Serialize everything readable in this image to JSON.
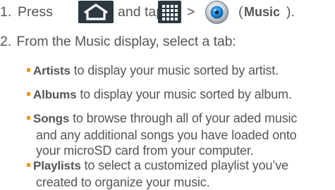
{
  "step1": {
    "number": "1.",
    "press": "Press",
    "and_tap": "and tap",
    "gt": ">",
    "open_paren": "(",
    "music": "Music",
    "close_paren": ")."
  },
  "step2": {
    "number": "2.",
    "text": "From the Music display, select a tab:"
  },
  "bullets": [
    {
      "term": "Artists",
      "lines": [
        "to display your music sorted by artist."
      ]
    },
    {
      "term": "Albums",
      "lines": [
        "to display your music sorted by album."
      ]
    },
    {
      "term": "Songs",
      "lines": [
        "to browse through all of your aded music",
        "and any additional songs you have loaded onto",
        "your microSD card from your computer."
      ]
    },
    {
      "term": "Playlists",
      "lines": [
        "to select a customized playlist you’ve",
        "created to organize your music."
      ]
    }
  ],
  "icons": {
    "home": "home-icon",
    "apps": "applications-grid-icon",
    "music": "music-app-icon"
  },
  "colors": {
    "text": "#555555",
    "bullet": "#f39200",
    "icon_bg": "#2c3840",
    "music_blue": "#1e88d8"
  }
}
